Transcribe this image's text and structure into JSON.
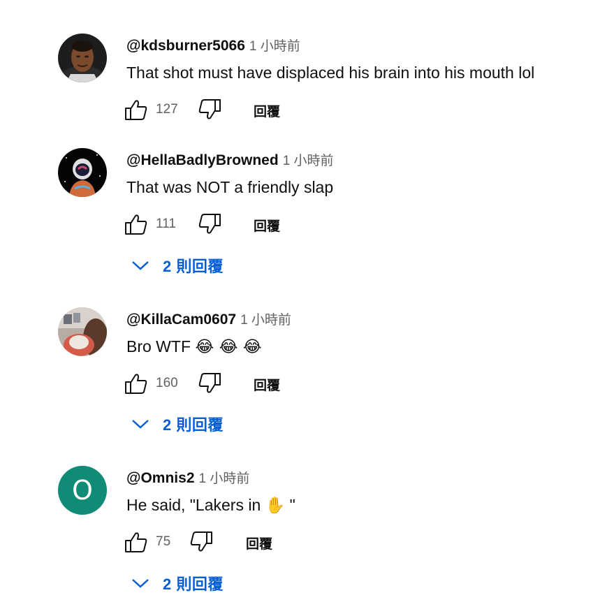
{
  "comments": [
    {
      "author": "@kdsburner5066",
      "time": "1 小時前",
      "text": "That shot must have displaced his brain into his mouth lol",
      "likes": "127",
      "reply_label": "回覆"
    },
    {
      "author": "@HellaBadlyBrowned",
      "time": "1 小時前",
      "text": "That was NOT a friendly slap",
      "likes": "111",
      "reply_label": "回覆",
      "replies_label": "2 則回覆"
    },
    {
      "author": "@KillaCam0607",
      "time": "1 小時前",
      "text": "Bro WTF",
      "emojis": "😂 😂 😂",
      "likes": "160",
      "reply_label": "回覆",
      "replies_label": "2 則回覆"
    },
    {
      "author": "@Omnis2",
      "time": "1 小時前",
      "text_before": "He said, \"Lakers in ",
      "hand_emoji": "✋",
      "text_after": " \"",
      "avatar_letter": "O",
      "avatar_color": "#0f8b76",
      "likes": "75",
      "reply_label": "回覆",
      "replies_label": "2 則回覆"
    }
  ],
  "colors": {
    "link_blue": "#065fd4",
    "secondary_text": "#606060",
    "primary_text": "#0f0f0f"
  },
  "icons": [
    "thumb-up-icon",
    "thumb-down-icon",
    "chevron-down-icon"
  ]
}
